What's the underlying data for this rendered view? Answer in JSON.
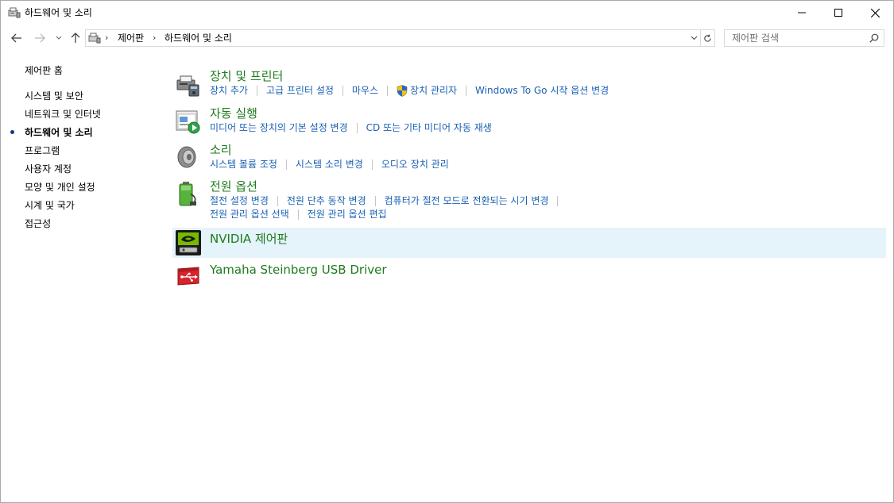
{
  "window": {
    "title": "하드웨어 및 소리"
  },
  "addressbar": {
    "crumbs": [
      "제어판",
      "하드웨어 및 소리"
    ],
    "search_placeholder": "제어판 검색"
  },
  "sidebar": {
    "items": [
      {
        "label": "제어판 홈"
      },
      {
        "label": "시스템 및 보안"
      },
      {
        "label": "네트워크 및 인터넷"
      },
      {
        "label": "하드웨어 및 소리",
        "active": true
      },
      {
        "label": "프로그램"
      },
      {
        "label": "사용자 계정"
      },
      {
        "label": "모양 및 개인 설정"
      },
      {
        "label": "시계 및 국가"
      },
      {
        "label": "접근성"
      }
    ]
  },
  "categories": [
    {
      "title": "장치 및 프린터",
      "icon": "printer-device-icon",
      "links": [
        "장치 추가",
        "고급 프린터 설정",
        "마우스",
        "장치 관리자",
        "Windows To Go 시작 옵션 변경"
      ]
    },
    {
      "title": "자동 실행",
      "icon": "autoplay-icon",
      "links": [
        "미디어 또는 장치의 기본 설정 변경",
        "CD 또는 기타 미디어 자동 재생"
      ]
    },
    {
      "title": "소리",
      "icon": "speaker-icon",
      "links": [
        "시스템 볼륨 조정",
        "시스템 소리 변경",
        "오디오 장치 관리"
      ]
    },
    {
      "title": "전원 옵션",
      "icon": "battery-power-icon",
      "links": [
        "절전 설정 변경",
        "전원 단추 동작 변경",
        "컴퓨터가 절전 모드로 전환되는 시기 변경",
        "전원 관리 옵션 선택",
        "전원 관리 옵션 편집"
      ]
    },
    {
      "title": "NVIDIA 제어판",
      "icon": "nvidia-icon",
      "links": []
    },
    {
      "title": "Yamaha Steinberg USB Driver",
      "icon": "usb-driver-icon",
      "links": []
    }
  ],
  "colors": {
    "category_title": "#1e7b1e",
    "link": "#1a61b3",
    "highlight": "#e5f3fb"
  }
}
